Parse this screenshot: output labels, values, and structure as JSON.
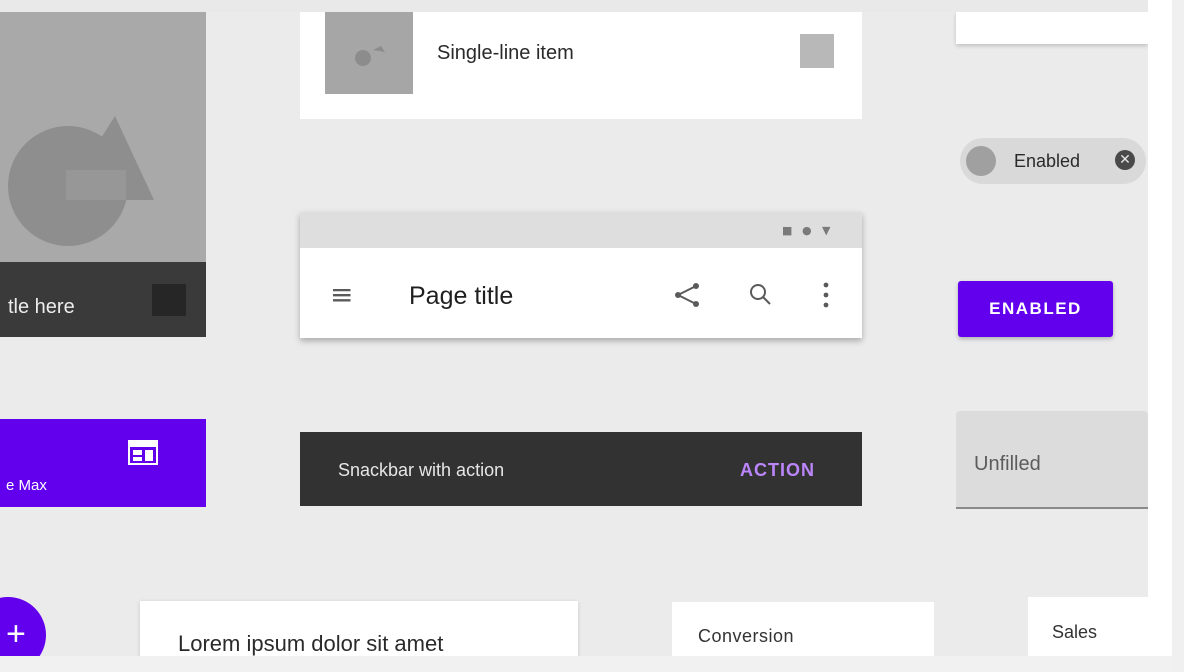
{
  "image_card": {
    "caption": "tle here"
  },
  "list_item": {
    "label": "Single-line item"
  },
  "chip": {
    "label": "Enabled",
    "close_glyph": "✕"
  },
  "app_bar": {
    "title": "Page title",
    "menu_glyph": "≡",
    "share_glyph": "<",
    "search_glyph": "⚲",
    "more_glyph": "⋮",
    "status_glyphs": [
      "■",
      "●",
      "▼"
    ]
  },
  "button": {
    "label": "ENABLED",
    "color": "#6200ee"
  },
  "date_card": {
    "text": "e Max"
  },
  "snackbar": {
    "message": "Snackbar with action",
    "action": "ACTION",
    "action_color": "#bb86fc"
  },
  "text_field": {
    "label": "Unfilled"
  },
  "fab": {
    "glyph": "+"
  },
  "lorem_card": {
    "text": "Lorem ipsum dolor sit amet"
  },
  "conversion_card": {
    "label": "Conversion"
  },
  "sales_card": {
    "label": "Sales"
  }
}
